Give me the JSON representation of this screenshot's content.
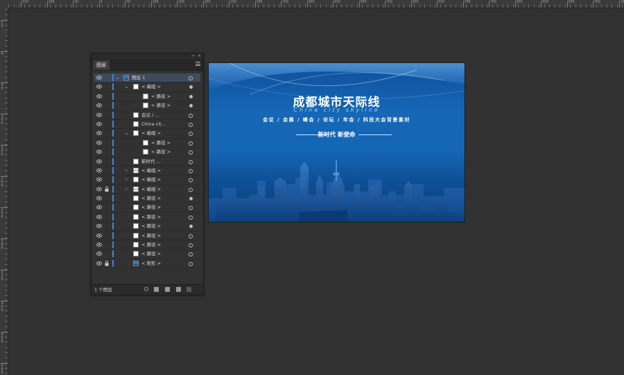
{
  "ruler_top_labels": [
    "150",
    "100",
    "50",
    "0",
    "50",
    "100",
    "150",
    "200",
    "250",
    "300",
    "350",
    "400",
    "450",
    "500",
    "550",
    "600",
    "650",
    "700",
    "750",
    "800",
    "850",
    "900",
    "950",
    "1000"
  ],
  "ruler_left_labels": [
    "50",
    "0",
    "50",
    "100",
    "150",
    "200",
    "250",
    "300",
    "350",
    "400",
    "450",
    "500"
  ],
  "layers_panel": {
    "tab_label": "图层",
    "footer_count": "1 个图层",
    "rows": [
      {
        "name": "图层 1"
      },
      {
        "name": "< 编组 >"
      },
      {
        "name": "< 路径 >"
      },
      {
        "name": "< 路径 >"
      },
      {
        "name": "会议 / ..."
      },
      {
        "name": "China cit..."
      },
      {
        "name": "< 编组 >"
      },
      {
        "name": "< 路径 >"
      },
      {
        "name": "< 路径 >"
      },
      {
        "name": "新时代  ..."
      },
      {
        "name": "< 编组 >"
      },
      {
        "name": "< 编组 >"
      },
      {
        "name": "< 编组 >"
      },
      {
        "name": "< 路径 >"
      },
      {
        "name": "< 路径 >"
      },
      {
        "name": "< 路径 >"
      },
      {
        "name": "< 路径 >"
      },
      {
        "name": "< 路径 >"
      },
      {
        "name": "< 路径 >"
      },
      {
        "name": "< 路径 >"
      },
      {
        "name": "< 矩形 >"
      }
    ]
  },
  "artboard": {
    "title": "成都城市天际线",
    "subtitle": "China city skyline",
    "tags": "会议 / 会展 / 峰会 / 论坛 / 年会 / 科技大会背景素材",
    "slogan": "新时代  新使命",
    "colors": {
      "background_top": "#0f4f9a",
      "background_bottom": "#0b3f7b",
      "skyline": "#3f7fc8"
    }
  }
}
